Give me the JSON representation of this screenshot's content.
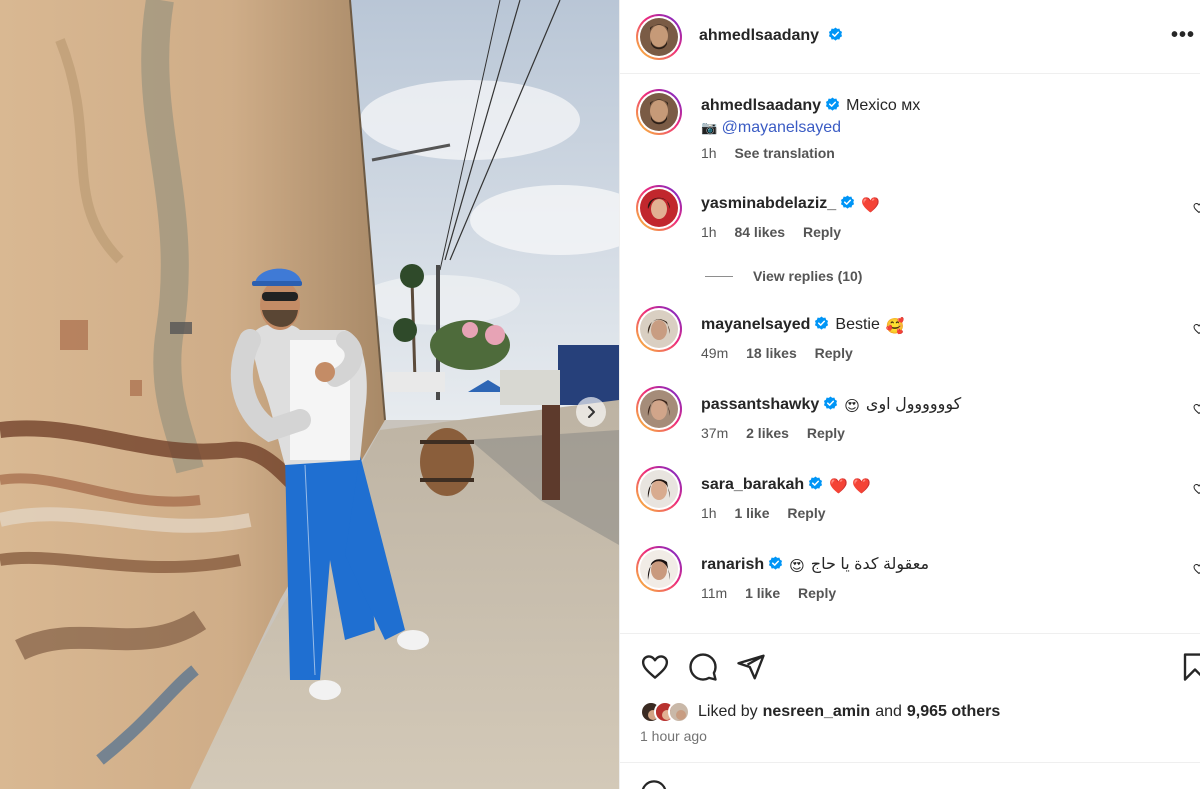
{
  "post": {
    "author": "ahmedlsaadany",
    "more_label": "•••"
  },
  "caption": {
    "username": "ahmedlsaadany",
    "text": "Mexico мх",
    "camera_emoji": "📷",
    "mention": "@mayanelsayed",
    "time": "1h",
    "see_translation": "See translation"
  },
  "comments": [
    {
      "username": "yasminabdelaziz_",
      "text": "",
      "emoji": "❤️",
      "time": "1h",
      "likes": "84 likes",
      "reply": "Reply",
      "view_replies": "View replies (10)"
    },
    {
      "username": "mayanelsayed",
      "text": "Bestie",
      "emoji": "🥰",
      "time": "49m",
      "likes": "18 likes",
      "reply": "Reply"
    },
    {
      "username": "passantshawky",
      "text": "كوووووول اوى",
      "emoji": "😍",
      "time": "37m",
      "likes": "2 likes",
      "reply": "Reply"
    },
    {
      "username": "sara_barakah",
      "text": "",
      "emoji": "❤️ ❤️",
      "time": "1h",
      "likes": "1 like",
      "reply": "Reply"
    },
    {
      "username": "ranarish",
      "text": "معقولة كدة يا حاج",
      "emoji": "😍",
      "time": "11m",
      "likes": "1 like",
      "reply": "Reply"
    }
  ],
  "likes": {
    "prefix": "Liked by",
    "user": "nesreen_amin",
    "middle": "and",
    "others": "9,965 others"
  },
  "posted": "1 hour ago",
  "colors": {
    "verified": "#0095f6",
    "heart": "#ff3040",
    "story_ring_start": "#f9ce34",
    "story_ring_end": "#6228d7"
  }
}
